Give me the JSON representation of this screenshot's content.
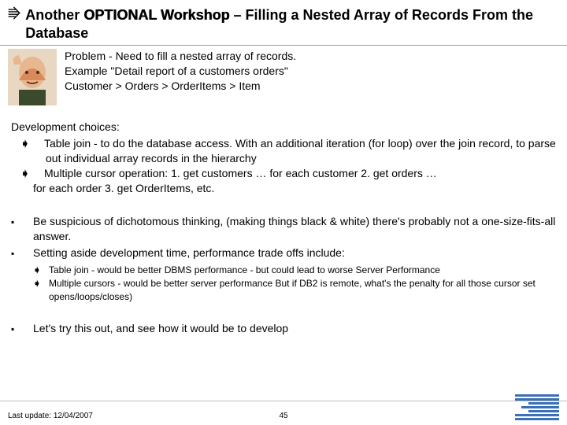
{
  "title": {
    "prefix": "Another ",
    "optional": "OPTIONAL Workshop",
    "suffix": " – Filling a Nested Array of Records From the Database"
  },
  "intro": {
    "l1": "Problem - Need to fill a nested array of records.",
    "l2": "Example \"Detail report of a customers orders\"",
    "l3": "Customer  >  Orders > OrderItems > Item"
  },
  "dev": {
    "heading": "Development choices:",
    "b1": "Table join - to do the database access.  With an additional iteration (for loop) over the join record, to parse out individual array records in the hierarchy",
    "b2": "Multiple cursor operation:  1. get customers … for each customer 2. get orders …",
    "trailing": "for each order 3. get OrderItems, etc."
  },
  "points": {
    "p1": "Be suspicious of dichotomous thinking, (making things black & white) there's probably not a one-size-fits-all answer.",
    "p2": "Setting aside development time, performance trade offs include:",
    "n1": "Table join - would be better DBMS performance - but could lead to worse Server Performance",
    "n2": "Multiple cursors - would be better server performance But if DB2 is remote, what's the penalty for all those cursor set opens/loops/closes)",
    "p3": "Let's try this out, and see how it would be to develop"
  },
  "footer": {
    "lastupdate": "Last update: 12/04/2007",
    "page": "45"
  }
}
